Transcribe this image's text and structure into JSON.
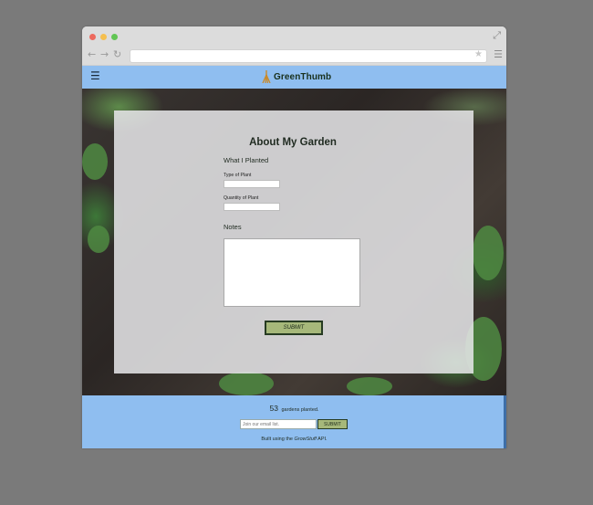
{
  "browser": {
    "back_icon": "arrow-left-icon",
    "forward_icon": "arrow-right-icon",
    "reload_icon": "reload-icon",
    "url": ""
  },
  "header": {
    "menu_icon": "hamburger-icon",
    "logo_text": "GreenThumb"
  },
  "card": {
    "title": "About My Garden",
    "section_planted": "What I Planted",
    "type_label": "Type of Plant",
    "type_value": "",
    "quantity_label": "Quantity of Plant",
    "quantity_value": "",
    "section_notes": "Notes",
    "notes_value": "",
    "submit_label": "SUBMIT"
  },
  "footer": {
    "gardens_count": "53",
    "gardens_text": "gardens planted.",
    "email_placeholder": "Join our email list.",
    "email_submit_label": "SUBMIT",
    "credit_prefix": "Built using the ",
    "credit_link": "GrowStuff",
    "credit_suffix": " API."
  },
  "colors": {
    "header_bg": "#8fbef0",
    "button_bg": "#a6b87a",
    "button_border": "#263b22"
  }
}
